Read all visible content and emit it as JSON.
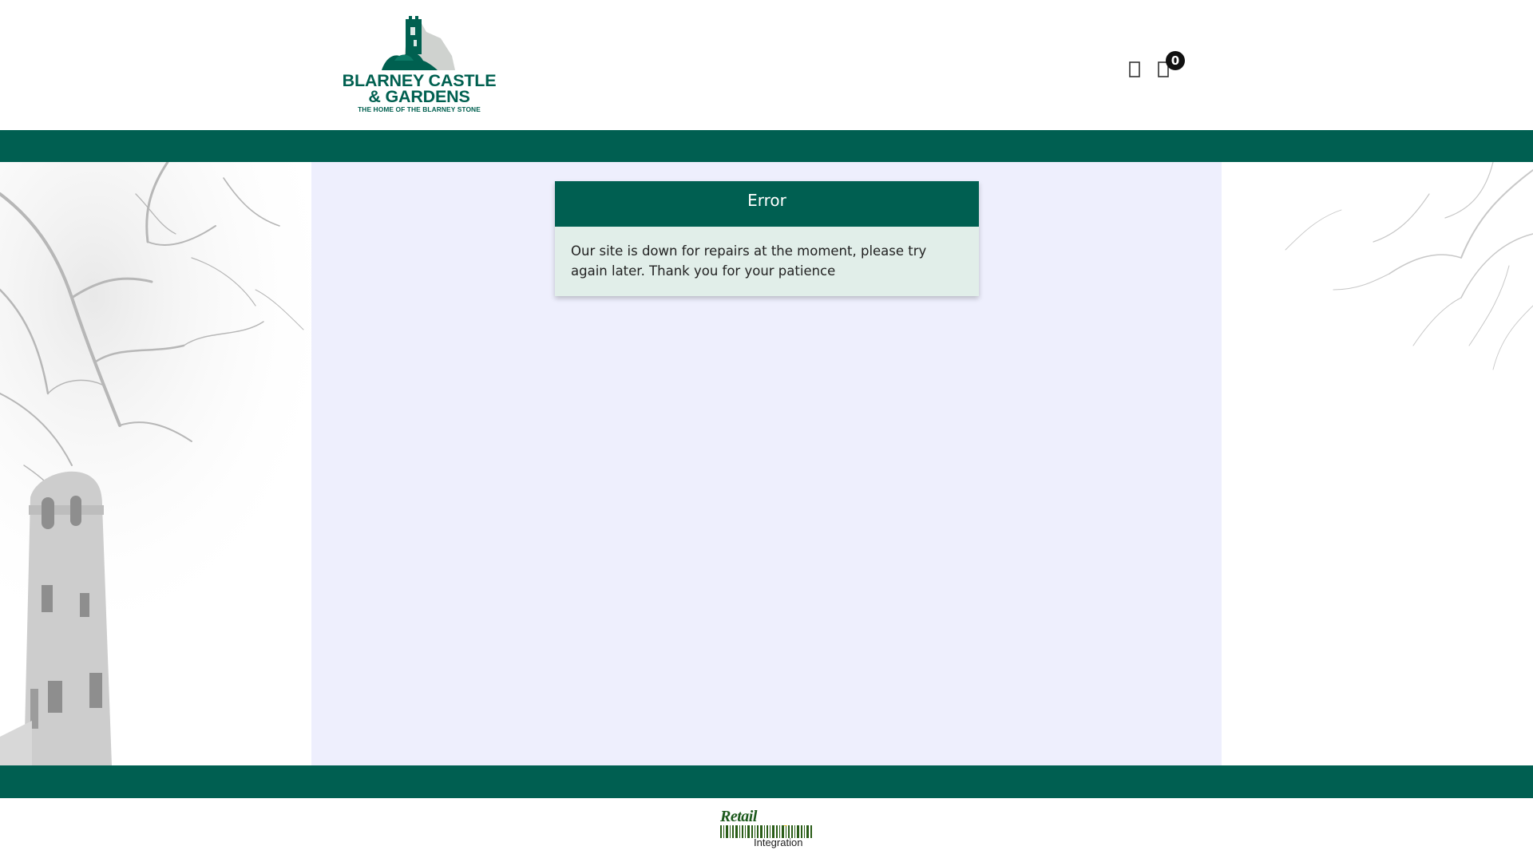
{
  "brand": {
    "line1": "BLARNEY CASTLE",
    "line2": "& GARDENS",
    "tagline": "THE HOME OF THE BLARNEY STONE",
    "color": "#006050"
  },
  "header": {
    "user_icon": "user-icon",
    "cart_icon": "shopping-bag-icon",
    "cart_count": "0"
  },
  "theme": {
    "primary": "#005f51",
    "panel_bg": "#eeeffd",
    "card_body_bg": "#e1eee9"
  },
  "error": {
    "title": "Error",
    "message": "Our site is down for repairs at the moment, please try again later. Thank you for your patience"
  },
  "footer": {
    "logo_word1": "Retail",
    "logo_word2": "Integration"
  }
}
